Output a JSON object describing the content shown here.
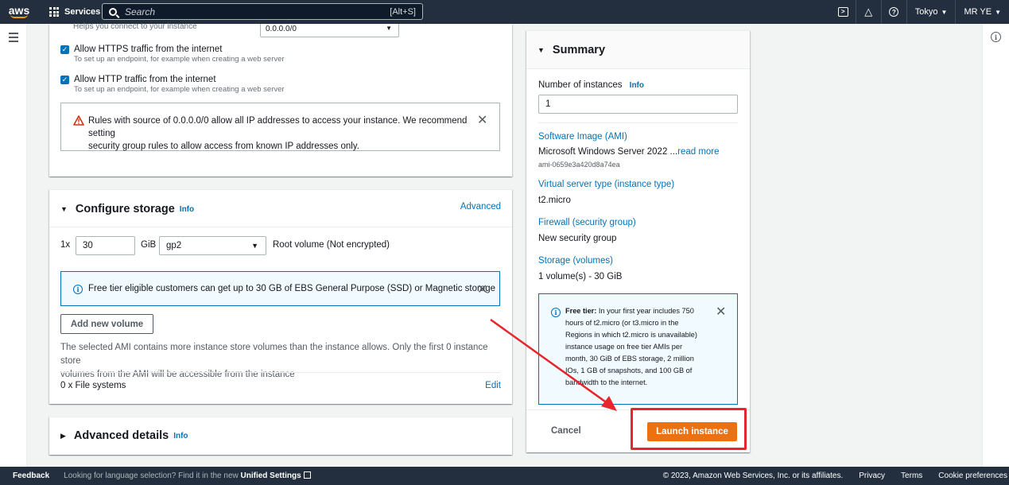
{
  "nav": {
    "logo": "aws",
    "services_label": "Services",
    "search_placeholder": "Search",
    "search_shortcut": "[Alt+S]",
    "region": "Tokyo",
    "user": "MR YE"
  },
  "network": {
    "cut_subtitle": "Helps you connect to your instance",
    "ip_value": "0.0.0.0/0",
    "https_title": "Allow HTTPS traffic from the internet",
    "https_sub": "To set up an endpoint, for example when creating a web server",
    "http_title": "Allow HTTP traffic from the internet",
    "http_sub": "To set up an endpoint, for example when creating a web server",
    "warning_line1": "Rules with source of 0.0.0.0/0 allow all IP addresses to access your instance. We recommend setting",
    "warning_line2": "security group rules to allow access from known IP addresses only."
  },
  "storage": {
    "title": "Configure storage",
    "info": "Info",
    "advanced": "Advanced",
    "count": "1x",
    "size_value": "30",
    "unit": "GiB",
    "volume_type": "gp2",
    "root_label": "Root volume  (Not encrypted)",
    "free_tier_notice": "Free tier eligible customers can get up to 30 GB of EBS General Purpose (SSD) or Magnetic storage",
    "add_volume": "Add new volume",
    "ami_note_line1": "The selected AMI contains more instance store volumes than the instance allows. Only the first 0 instance store",
    "ami_note_line2": "volumes from the AMI will be accessible from the instance",
    "file_systems": "0 x File systems",
    "edit": "Edit"
  },
  "advanced_details": {
    "title": "Advanced details",
    "info": "Info"
  },
  "summary": {
    "title": "Summary",
    "instances_label": "Number of instances",
    "info": "Info",
    "instances_value": "1",
    "ami_label": "Software Image (AMI)",
    "ami_value": "Microsoft Windows Server 2022 ...",
    "read_more": "read more",
    "ami_id": "ami-0659e3a420d8a74ea",
    "type_label": "Virtual server type (instance type)",
    "type_value": "t2.micro",
    "firewall_label": "Firewall (security group)",
    "firewall_value": "New security group",
    "storage_label": "Storage (volumes)",
    "storage_value": "1 volume(s) - 30 GiB",
    "free_tier_bold": "Free tier:",
    "free_tier_text": " In your first year includes 750 hours of t2.micro (or t3.micro in the Regions in which t2.micro is unavailable) instance usage on free tier AMIs per month, 30 GiB of EBS storage, 2 million IOs, 1 GB of snapshots, and 100 GB of bandwidth to the internet.",
    "cancel": "Cancel",
    "launch": "Launch instance"
  },
  "footer": {
    "feedback": "Feedback",
    "lang_text": "Looking for language selection? Find it in the new ",
    "unified": "Unified Settings",
    "copyright": "© 2023, Amazon Web Services, Inc. or its affiliates.",
    "privacy": "Privacy",
    "terms": "Terms",
    "cookies": "Cookie preferences"
  },
  "colors": {
    "nav_bg": "#232f3e",
    "link": "#0073bb",
    "primary": "#ec7211",
    "annotation": "#e6262d"
  }
}
